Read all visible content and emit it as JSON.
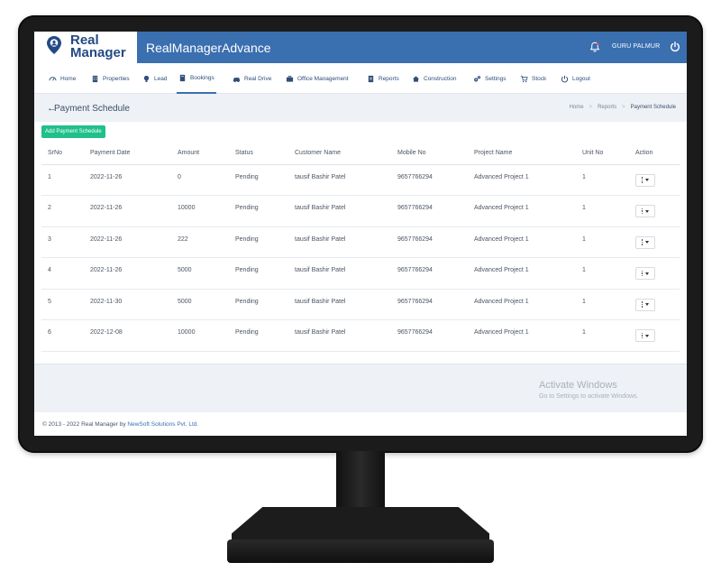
{
  "app": {
    "logo_line1": "Real",
    "logo_line2": "Manager",
    "title": "RealManagerAdvance",
    "user": "GURU PALMUR"
  },
  "nav": [
    {
      "label": "Home",
      "icon": "dashboard-icon"
    },
    {
      "label": "Properties",
      "icon": "building-icon"
    },
    {
      "label": "Lead",
      "icon": "bulb-icon"
    },
    {
      "label": "Bookings",
      "icon": "book-icon",
      "active": true
    },
    {
      "label": "Real Drive",
      "icon": "car-icon"
    },
    {
      "label": "Office Management",
      "icon": "briefcase-icon"
    },
    {
      "label": "Reports",
      "icon": "report-icon"
    },
    {
      "label": "Construction",
      "icon": "home-icon"
    },
    {
      "label": "Settings",
      "icon": "gears-icon"
    },
    {
      "label": "Stock",
      "icon": "cart-icon"
    },
    {
      "label": "Logout",
      "icon": "power-icon"
    }
  ],
  "page": {
    "title": "Payment Schedule",
    "breadcrumb": [
      "Home",
      "Reports",
      "Payment Schedule"
    ],
    "add_button": "Add Payment Schedule"
  },
  "table": {
    "columns": [
      "SrNo",
      "Payment Date",
      "Amount",
      "Status",
      "Customer Name",
      "Mobile No",
      "Project Name",
      "Unit No",
      "Action"
    ],
    "rows": [
      [
        "1",
        "2022-11-26",
        "0",
        "Pending",
        "tausif Bashir Patel",
        "9657766294",
        "Advanced Project 1",
        "1"
      ],
      [
        "2",
        "2022-11-26",
        "10000",
        "Pending",
        "tausif Bashir Patel",
        "9657766294",
        "Advanced Project 1",
        "1"
      ],
      [
        "3",
        "2022-11-26",
        "222",
        "Pending",
        "tausif Bashir Patel",
        "9657766294",
        "Advanced Project 1",
        "1"
      ],
      [
        "4",
        "2022-11-26",
        "5000",
        "Pending",
        "tausif Bashir Patel",
        "9657766294",
        "Advanced Project 1",
        "1"
      ],
      [
        "5",
        "2022-11-30",
        "5000",
        "Pending",
        "tausif Bashir Patel",
        "9657766294",
        "Advanced Project 1",
        "1"
      ],
      [
        "6",
        "2022-12-08",
        "10000",
        "Pending",
        "tausif Bashir Patel",
        "9657766294",
        "Advanced Project 1",
        "1"
      ]
    ]
  },
  "watermark": {
    "title": "Activate Windows",
    "subtitle": "Go to Settings to activate Windows."
  },
  "footer": {
    "text": "© 2013 - 2022 Real Manager by ",
    "link": "NewSoft Solutions Pvt. Ltd."
  },
  "colors": {
    "brand": "#3a6fb0",
    "add_button": "#1fc089",
    "monitor": "#1b1b1b"
  }
}
